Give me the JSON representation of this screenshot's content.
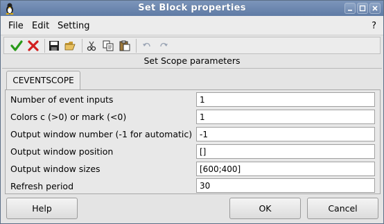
{
  "window": {
    "title": "Set Block properties",
    "controls": [
      "minimize-icon",
      "maximize-icon",
      "close-icon"
    ]
  },
  "menu": {
    "file": "File",
    "edit": "Edit",
    "setting": "Setting",
    "help": "?"
  },
  "toolbar": {
    "icons": [
      "check-icon",
      "cancel-icon",
      "save-icon",
      "open-icon",
      "cut-icon",
      "copy-icon",
      "paste-icon",
      "undo-icon",
      "redo-icon"
    ]
  },
  "header": {
    "label": "Set Scope parameters"
  },
  "tab": {
    "label": "CEVENTSCOPE"
  },
  "fields": [
    {
      "label": "Number of event inputs",
      "value": "1"
    },
    {
      "label": "Colors c (>0) or mark (<0)",
      "value": "1"
    },
    {
      "label": "Output window number (-1 for automatic)",
      "value": "-1"
    },
    {
      "label": "Output window position",
      "value": "[]"
    },
    {
      "label": "Output window sizes",
      "value": "[600;400]"
    },
    {
      "label": "Refresh period",
      "value": "30"
    }
  ],
  "buttons": {
    "help": "Help",
    "ok": "OK",
    "cancel": "Cancel"
  },
  "colors": {
    "titlebar": "#6a85ad",
    "check": "#2a9a1a",
    "cancel": "#d21e1e"
  }
}
